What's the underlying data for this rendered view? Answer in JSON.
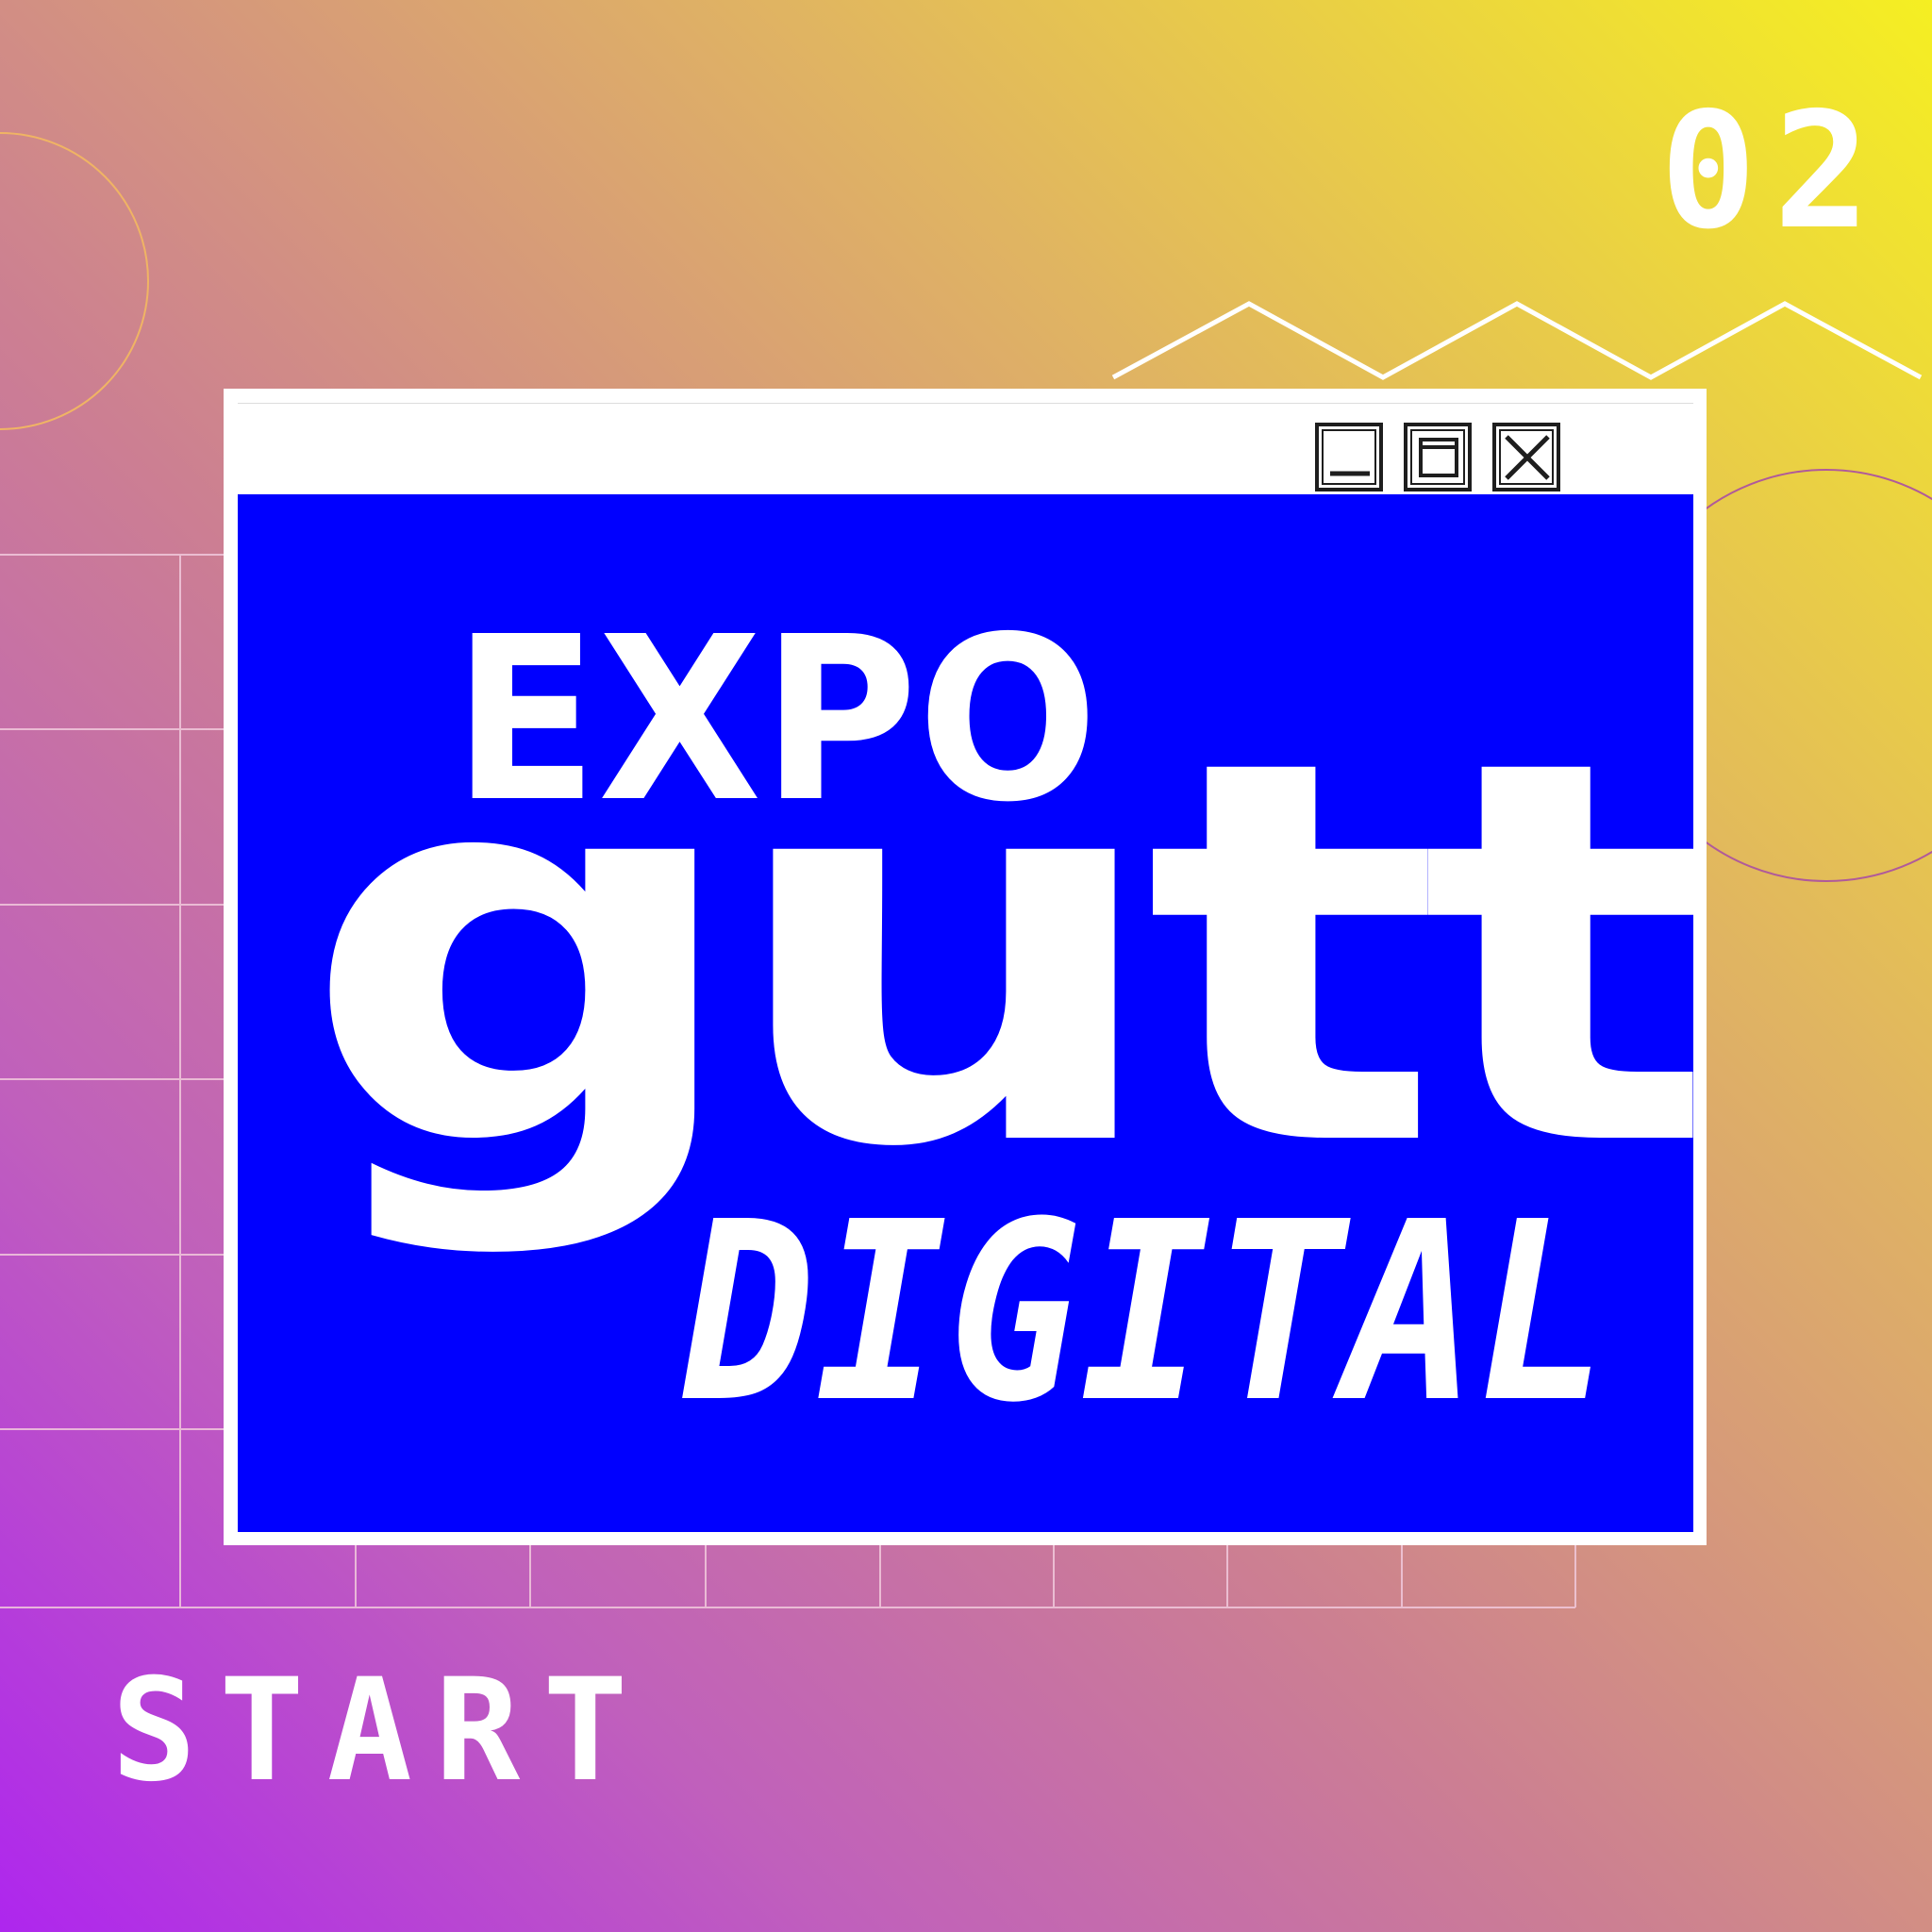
{
  "page_number": "02",
  "start_label": "START",
  "window": {
    "controls": [
      "minimize-icon",
      "restore-icon",
      "close-icon"
    ]
  },
  "logo": {
    "line1": "EXPO",
    "line2": "gutt",
    "line3": "DIGITAL"
  },
  "colors": {
    "window_content": "#0000ff",
    "window_frame": "#ffffff",
    "text": "#ffffff",
    "icon_stroke": "#1e1e1e"
  }
}
